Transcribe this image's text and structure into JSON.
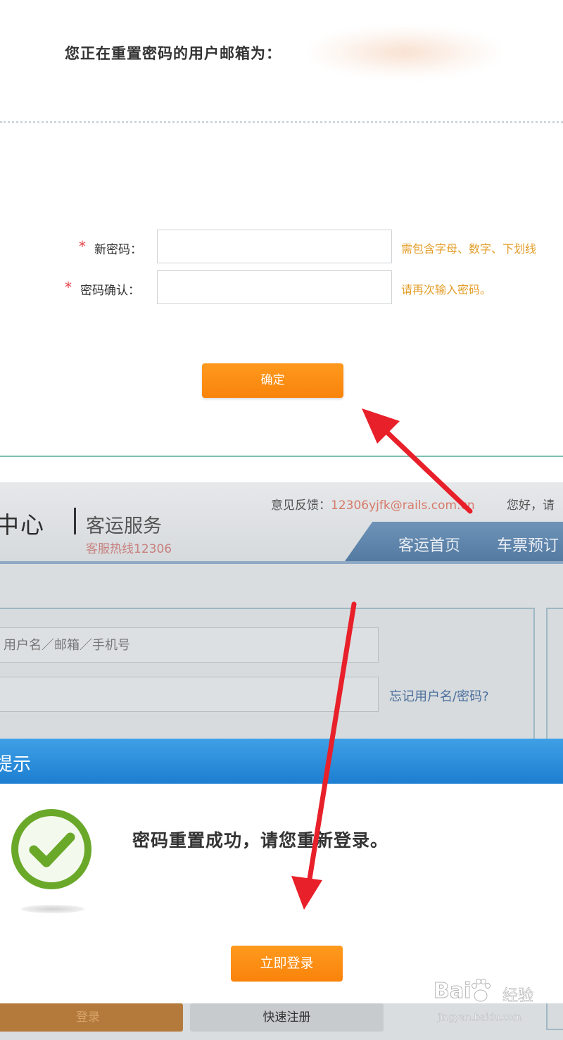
{
  "reset_form": {
    "email_label": "您正在重置密码的用户邮箱为：",
    "new_password": {
      "required_mark": "*",
      "label": "新密码：",
      "value": "",
      "hint": "需包含字母、数字、下划线"
    },
    "confirm_password": {
      "required_mark": "*",
      "label": "密码确认：",
      "value": "",
      "hint": "请再次输入密码。"
    },
    "confirm_button": "确定"
  },
  "site": {
    "logo_text": "中心",
    "service_title": "客运服务",
    "hotline": "客服热线12306",
    "feedback_label": "意见反馈：",
    "feedback_email": "12306yjfk@rails.com.cn",
    "greeting": "您好，请",
    "nav": {
      "home": "客运首页",
      "tickets": "车票预订"
    }
  },
  "login": {
    "username_placeholder": "用户名／邮箱／手机号",
    "forgot_link": "忘记用户名/密码?",
    "login_button": "登录",
    "register_button": "快速注册"
  },
  "dialog": {
    "title": "提示",
    "message": "密码重置成功，请您重新登录。",
    "login_now_button": "立即登录"
  },
  "watermark": {
    "logo": "Bai",
    "brand": "经验",
    "url": "jingyan.baidu.com"
  },
  "colors": {
    "accent_orange": "#f9830b",
    "annotation_red": "#e8202a",
    "dialog_blue": "#1d7ed1",
    "success_green": "#6aa82a"
  }
}
